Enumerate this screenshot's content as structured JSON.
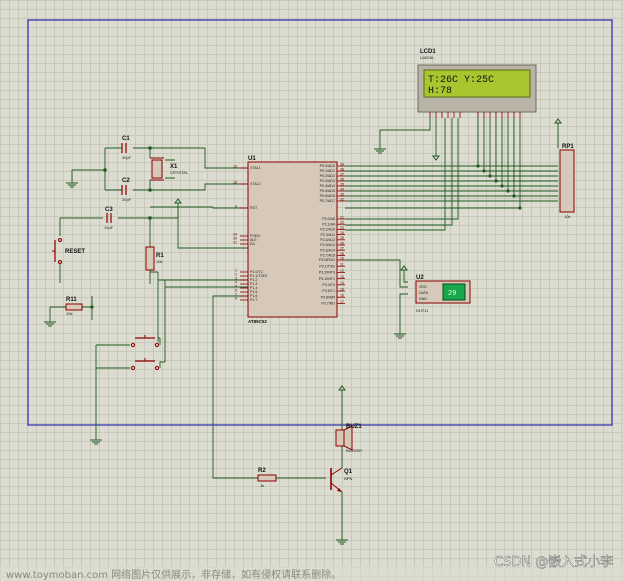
{
  "colors": {
    "wire": "#1f5a1f",
    "component": "#8b0000",
    "body_fill": "#d6c9b9",
    "frame": "#2a2ab0",
    "lcd_screen": "#a9c62e",
    "sensor_screen": "#1aa64a"
  },
  "lcd": {
    "ref": "LCD1",
    "model": "LM016L",
    "line1": "T:26C  Y:25C",
    "line2": "H:78"
  },
  "mcu": {
    "ref": "U1",
    "model": "AT89C52",
    "left_pins": [
      {
        "num": "19",
        "name": "XTAL1"
      },
      {
        "num": "18",
        "name": "XTAL2"
      },
      {
        "num": "9",
        "name": "RST"
      },
      {
        "num": "29",
        "name": "PSEN"
      },
      {
        "num": "30",
        "name": "ALE"
      },
      {
        "num": "31",
        "name": "EA"
      },
      {
        "num": "1",
        "name": "P1.0/T2"
      },
      {
        "num": "2",
        "name": "P1.1/T2EX"
      },
      {
        "num": "3",
        "name": "P1.2"
      },
      {
        "num": "4",
        "name": "P1.3"
      },
      {
        "num": "5",
        "name": "P1.4"
      },
      {
        "num": "6",
        "name": "P1.5"
      },
      {
        "num": "7",
        "name": "P1.6"
      },
      {
        "num": "8",
        "name": "P1.7"
      }
    ],
    "right_pins": [
      {
        "num": "39",
        "name": "P0.0/AD0"
      },
      {
        "num": "38",
        "name": "P0.1/AD1"
      },
      {
        "num": "37",
        "name": "P0.2/AD2"
      },
      {
        "num": "36",
        "name": "P0.3/AD3"
      },
      {
        "num": "35",
        "name": "P0.4/AD4"
      },
      {
        "num": "34",
        "name": "P0.5/AD5"
      },
      {
        "num": "33",
        "name": "P0.6/AD6"
      },
      {
        "num": "32",
        "name": "P0.7/AD7"
      },
      {
        "num": "21",
        "name": "P2.0/A8"
      },
      {
        "num": "22",
        "name": "P2.1/A9"
      },
      {
        "num": "23",
        "name": "P2.2/A10"
      },
      {
        "num": "24",
        "name": "P2.3/A11"
      },
      {
        "num": "25",
        "name": "P2.4/A12"
      },
      {
        "num": "26",
        "name": "P2.5/A13"
      },
      {
        "num": "27",
        "name": "P2.6/A14"
      },
      {
        "num": "28",
        "name": "P2.7/A15"
      },
      {
        "num": "10",
        "name": "P3.0/RXD"
      },
      {
        "num": "11",
        "name": "P3.1/TXD"
      },
      {
        "num": "12",
        "name": "P3.2/INT0"
      },
      {
        "num": "13",
        "name": "P3.3/INT1"
      },
      {
        "num": "14",
        "name": "P3.4/T0"
      },
      {
        "num": "15",
        "name": "P3.5/T1"
      },
      {
        "num": "16",
        "name": "P3.6/WR"
      },
      {
        "num": "17",
        "name": "P3.7/RD"
      }
    ]
  },
  "crystal": {
    "ref": "X1",
    "model": "CRYSTAL"
  },
  "c1": {
    "ref": "C1",
    "value": "30pF"
  },
  "c2": {
    "ref": "C2",
    "value": "30pF"
  },
  "c3": {
    "ref": "C3",
    "value": "10uF"
  },
  "r1": {
    "ref": "R1",
    "value": "10k"
  },
  "r11": {
    "ref": "R11",
    "value": "10k"
  },
  "r2": {
    "ref": "R2",
    "value": "1k"
  },
  "reset": {
    "label": "RESET"
  },
  "rp1": {
    "ref": "RP1",
    "value": "10k"
  },
  "sensor": {
    "ref": "U2",
    "model": "DHT11",
    "pins": [
      "VDD",
      "DATA",
      "GND"
    ],
    "reading": "29"
  },
  "buzzer": {
    "ref": "BUZ1",
    "model": "BUZZER"
  },
  "transistor": {
    "ref": "Q1",
    "model": "NPN"
  },
  "watermark": {
    "left": "www.toymoban.com 网络图片仅供展示，非存储，如有侵权请联系删除。",
    "right": "CSDN @嵌入式小李"
  }
}
